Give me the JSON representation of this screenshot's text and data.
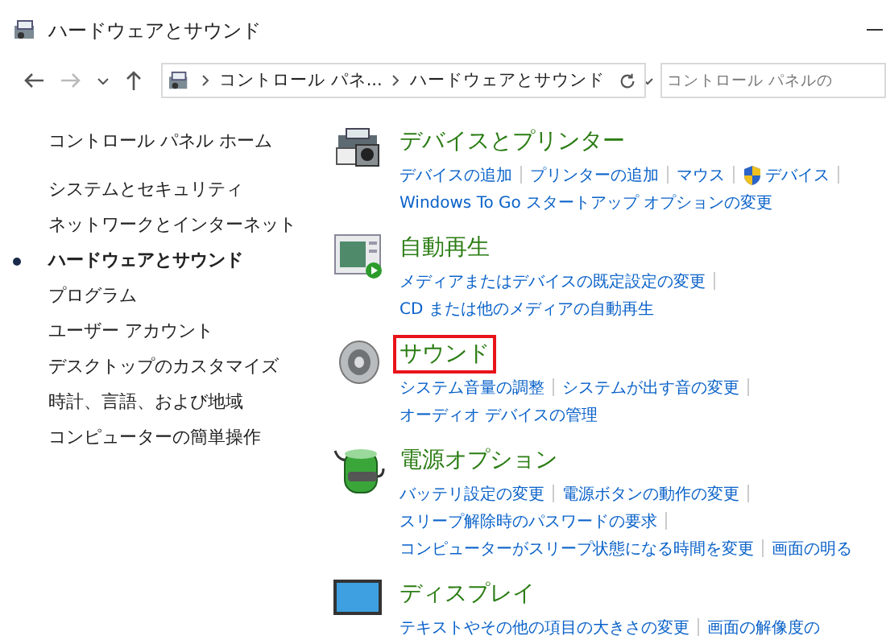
{
  "window": {
    "title": "ハードウェアとサウンド"
  },
  "address_bar": {
    "crumbs": [
      "コントロール パネ...",
      "ハードウェアとサウンド"
    ]
  },
  "search": {
    "placeholder": "コントロール パネルの"
  },
  "sidebar": {
    "home": "コントロール パネル ホーム",
    "items": [
      {
        "label": "システムとセキュリティ",
        "selected": false
      },
      {
        "label": "ネットワークとインターネット",
        "selected": false
      },
      {
        "label": "ハードウェアとサウンド",
        "selected": true
      },
      {
        "label": "プログラム",
        "selected": false
      },
      {
        "label": "ユーザー アカウント",
        "selected": false
      },
      {
        "label": "デスクトップのカスタマイズ",
        "selected": false
      },
      {
        "label": "時計、言語、および地域",
        "selected": false
      },
      {
        "label": "コンピューターの簡単操作",
        "selected": false
      }
    ]
  },
  "categories": [
    {
      "kind": "devices",
      "title": "デバイスとプリンター",
      "highlighted": false,
      "rows": [
        [
          {
            "label": "デバイスの追加",
            "shield": false
          },
          {
            "label": "プリンターの追加",
            "shield": false
          },
          {
            "label": "マウス",
            "shield": false
          },
          {
            "label": "デバイス",
            "shield": true
          }
        ],
        [
          {
            "label": "Windows To Go スタートアップ オプションの変更",
            "shield": false
          }
        ]
      ]
    },
    {
      "kind": "autoplay",
      "title": "自動再生",
      "highlighted": false,
      "rows": [
        [
          {
            "label": "メディアまたはデバイスの既定設定の変更",
            "shield": false
          }
        ],
        [
          {
            "label": "CD または他のメディアの自動再生",
            "shield": false
          }
        ]
      ]
    },
    {
      "kind": "sound",
      "title": "サウンド",
      "highlighted": true,
      "rows": [
        [
          {
            "label": "システム音量の調整",
            "shield": false
          },
          {
            "label": "システムが出す音の変更",
            "shield": false
          }
        ],
        [
          {
            "label": "オーディオ デバイスの管理",
            "shield": false
          }
        ]
      ]
    },
    {
      "kind": "power",
      "title": "電源オプション",
      "highlighted": false,
      "rows": [
        [
          {
            "label": "バッテリ設定の変更",
            "shield": false
          },
          {
            "label": "電源ボタンの動作の変更",
            "shield": false
          }
        ],
        [
          {
            "label": "スリープ解除時のパスワードの要求",
            "shield": false
          }
        ],
        [
          {
            "label": "コンピューターがスリープ状態になる時間を変更",
            "shield": false
          },
          {
            "label": "画面の明る",
            "shield": false
          }
        ]
      ]
    },
    {
      "kind": "display",
      "title": "ディスプレイ",
      "highlighted": false,
      "rows": [
        [
          {
            "label": "テキストやその他の項目の大きさの変更",
            "shield": false
          },
          {
            "label": "画面の解像度の",
            "shield": false
          }
        ]
      ]
    }
  ]
}
